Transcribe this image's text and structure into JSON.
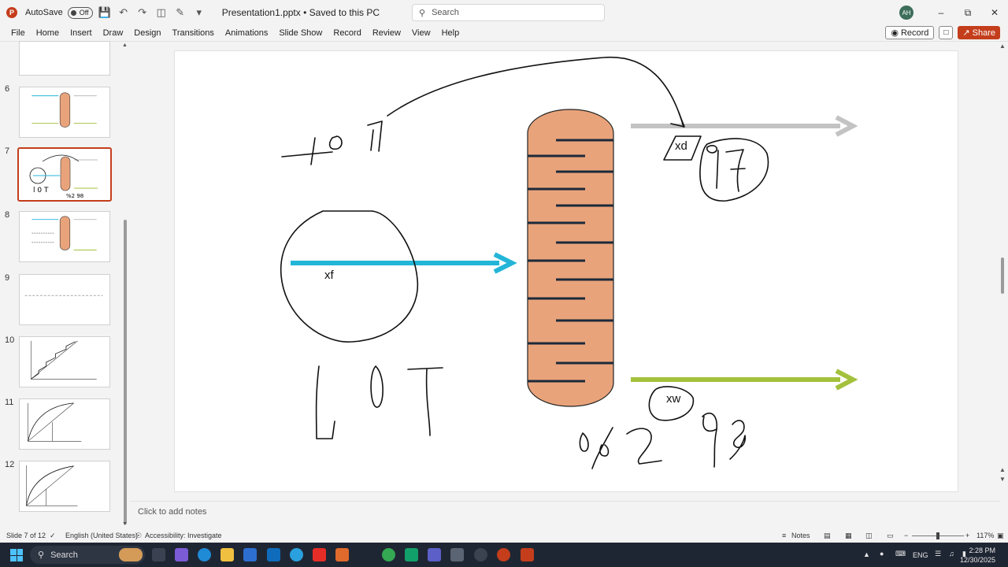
{
  "titlebar": {
    "app_logo": "P",
    "autosave_label": "AutoSave",
    "autosave_state": "Off",
    "document_title": "Presentation1.pptx • Saved to this PC",
    "search_placeholder": "Search",
    "user_initials": "AH"
  },
  "ribbon": {
    "tabs": [
      "File",
      "Home",
      "Insert",
      "Draw",
      "Design",
      "Transitions",
      "Animations",
      "Slide Show",
      "Record",
      "Review",
      "View",
      "Help"
    ],
    "record_button": "Record",
    "share_button": "Share"
  },
  "thumbnails": {
    "numbers": [
      "6",
      "7",
      "8",
      "9",
      "10",
      "11",
      "12"
    ],
    "active_index": 1
  },
  "slide": {
    "label_xf": "xf",
    "label_xd": "xd",
    "label_xw": "xw"
  },
  "notes_placeholder": "Click to add notes",
  "statusbar": {
    "slide_info": "Slide 7 of 12",
    "language": "English (United States)",
    "accessibility": "Accessibility: Investigate",
    "notes_button": "Notes",
    "zoom": "117%"
  },
  "taskbar": {
    "search_label": "Search",
    "language": "ENG",
    "time": "2:28 PM",
    "date": "12/30/2025"
  },
  "colors": {
    "accent": "#c43e1c",
    "column_fill": "#e9a37b",
    "feed_arrow": "#23b5d8",
    "distillate_arrow": "#c3c3c3",
    "bottoms_arrow": "#a4c13c"
  }
}
